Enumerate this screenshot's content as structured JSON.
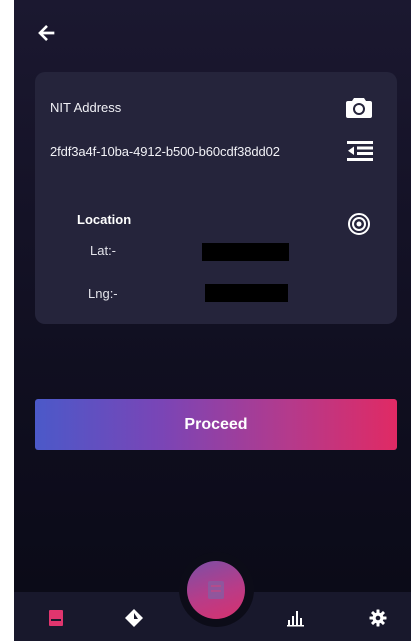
{
  "header": {
    "back_icon": "arrow-left-icon"
  },
  "card": {
    "nit_label": "NIT Address",
    "nit_value": "2fdf3a4f-10ba-4912-b500-b60cdf38dd02",
    "camera_icon": "camera-icon",
    "list_icon": "list-indent-icon",
    "location_label": "Location",
    "target_icon": "target-icon",
    "lat_label": "Lat:-",
    "lng_label": "Lng:-"
  },
  "proceed_label": "Proceed",
  "nav": {
    "items": [
      {
        "icon": "wallet-icon",
        "active": true
      },
      {
        "icon": "diamond-icon",
        "active": false
      },
      {
        "icon": "scan-icon",
        "active": false
      },
      {
        "icon": "bar-chart-icon",
        "active": false
      },
      {
        "icon": "gear-icon",
        "active": false
      }
    ]
  },
  "colors": {
    "accent_pink": "#e02a64",
    "accent_blue": "#4b59c9",
    "card_bg": "#25243b",
    "nav_active": "#e0356e"
  }
}
